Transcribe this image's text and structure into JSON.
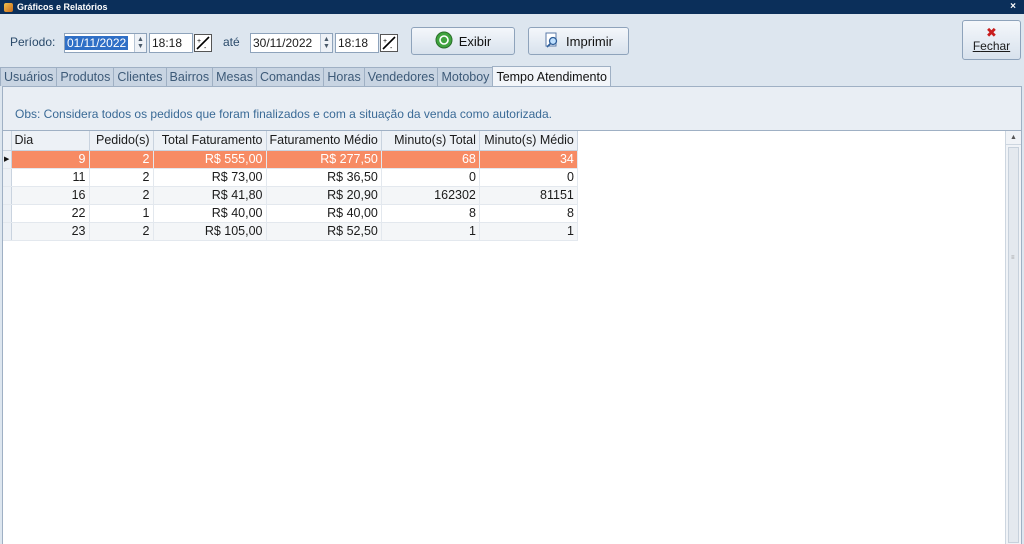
{
  "window": {
    "title": "Gráficos e Relatórios",
    "close": "×"
  },
  "toolbar": {
    "periodo_label": "Período:",
    "date_start": "01/11/2022",
    "time_start": "18:18",
    "ate_label": "até",
    "date_end": "30/11/2022",
    "time_end": "18:18",
    "exibir_label": "Exibir",
    "imprimir_label": "Imprimir",
    "fechar_label": "Fechar"
  },
  "tabs": [
    "Usuários",
    "Produtos",
    "Clientes",
    "Bairros",
    "Mesas",
    "Comandas",
    "Horas",
    "Vendedores",
    "Motoboy",
    "Tempo Atendimento"
  ],
  "active_tab": "Tempo Atendimento",
  "obs": "Obs: Considera todos os pedidos que foram finalizados e com a situação da venda como autorizada.",
  "grid": {
    "columns": [
      "Dia",
      "Pedido(s)",
      "Total Faturamento",
      "Faturamento Médio",
      "Minuto(s) Total",
      "Minuto(s) Médio"
    ],
    "rows": [
      [
        "9",
        "2",
        "R$ 555,00",
        "R$ 277,50",
        "68",
        "34"
      ],
      [
        "11",
        "2",
        "R$ 73,00",
        "R$ 36,50",
        "0",
        "0"
      ],
      [
        "16",
        "2",
        "R$ 41,80",
        "R$ 20,90",
        "162302",
        "81151"
      ],
      [
        "22",
        "1",
        "R$ 40,00",
        "R$ 40,00",
        "8",
        "8"
      ],
      [
        "23",
        "2",
        "R$ 105,00",
        "R$ 52,50",
        "1",
        "1"
      ]
    ],
    "selected_row": 0
  },
  "colors": {
    "selected_row": "#f78b64",
    "titlebar": "#0b2f5a",
    "accent_text": "#3a6a96"
  }
}
